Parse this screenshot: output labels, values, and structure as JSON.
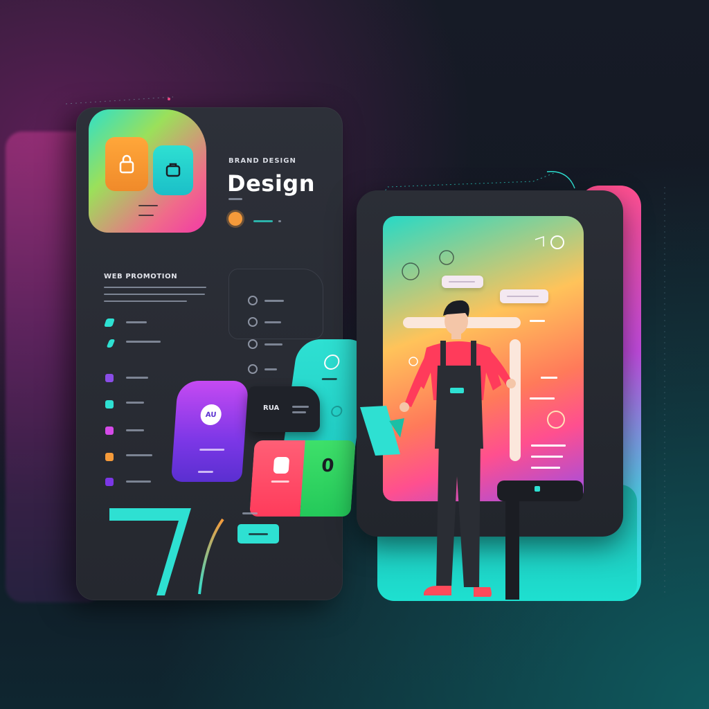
{
  "left_panel": {
    "kicker": "BRAND DESIGN",
    "title": "Design",
    "section_label": "WEB PROMOTION",
    "nav_items": [
      {
        "icon_color": "#2ee0d2"
      },
      {
        "icon_color": "#2ee0d2"
      },
      {
        "icon_color": "#8a4de6"
      },
      {
        "icon_color": "#2ee0d2"
      },
      {
        "icon_color": "#d54ae8"
      },
      {
        "icon_color": "#f59a3a"
      },
      {
        "icon_color": "#7b37e6"
      }
    ],
    "dark_chip_label": "RUA",
    "purple_card_badge": "AU",
    "pink_card_digit": "0"
  },
  "colors": {
    "accent_teal": "#2ee0d2",
    "accent_pink": "#ff4f8f",
    "accent_purple": "#7b37e6",
    "panel_dark": "#2b2e36",
    "overall_shirt": "#ff3b5b"
  }
}
